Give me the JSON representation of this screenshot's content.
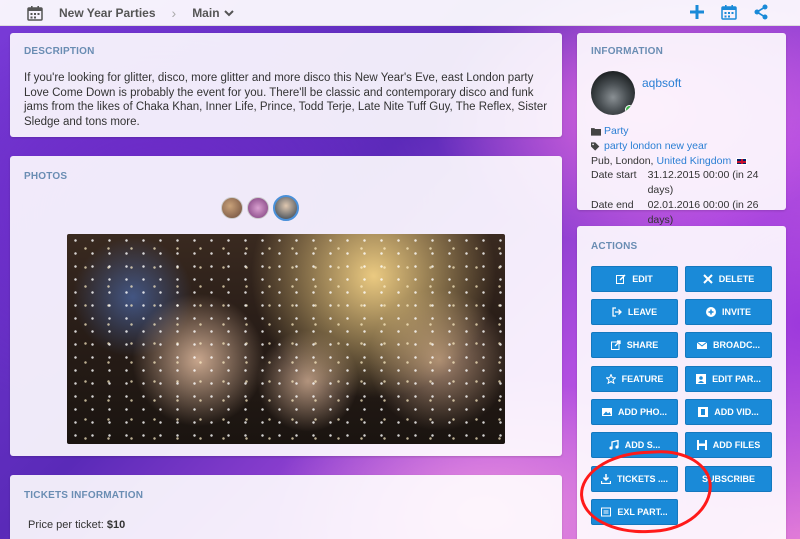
{
  "topbar": {
    "event_title": "New Year Parties",
    "separator": "›",
    "main_label": "Main"
  },
  "description": {
    "title": "DESCRIPTION",
    "text": "If you're looking for glitter, disco, more glitter and more disco this New Year's Eve, east London party Love Come Down is probably the event for you. There'll be classic and contemporary disco and funk jams from the likes of Chaka Khan, Inner Life, Prince, Todd Terje, Late Nite Tuff Guy, The Reflex, Sister Sledge and tons more."
  },
  "photos": {
    "title": "PHOTOS",
    "thumb_count": 3,
    "active_thumb": 3
  },
  "tickets": {
    "title": "TICKETS INFORMATION",
    "price_label": "Price per ticket:",
    "price_value": "$10"
  },
  "info": {
    "title": "INFORMATION",
    "username": "aqbsoft",
    "category": "Party",
    "tags": "party london new year",
    "location_prefix": "Pub, London,",
    "country": "United Kingdom",
    "date_start_label": "Date start",
    "date_start_value": "31.12.2015 00:00 (in 24 days)",
    "date_end_label": "Date end",
    "date_end_value": "02.01.2016 00:00 (in 26 days)"
  },
  "actions": {
    "title": "ACTIONS",
    "edit": "EDIT",
    "delete": "DELETE",
    "leave": "LEAVE",
    "invite": "INVITE",
    "share": "SHARE",
    "broadcast": "BROADC...",
    "feature": "FEATURE",
    "edit_participants": "EDIT PAR...",
    "add_photos": "ADD PHO...",
    "add_videos": "ADD VID...",
    "add_sounds": "ADD S...",
    "add_files": "ADD FILES",
    "tickets": "TICKETS ....",
    "subscribe": "SUBSCRIBE",
    "export_participants": "EXL PART..."
  },
  "colors": {
    "button": "#1a8ad8",
    "link": "#2a7fd4",
    "section_title": "#6a8db3",
    "annotation": "#ff1a1a"
  }
}
